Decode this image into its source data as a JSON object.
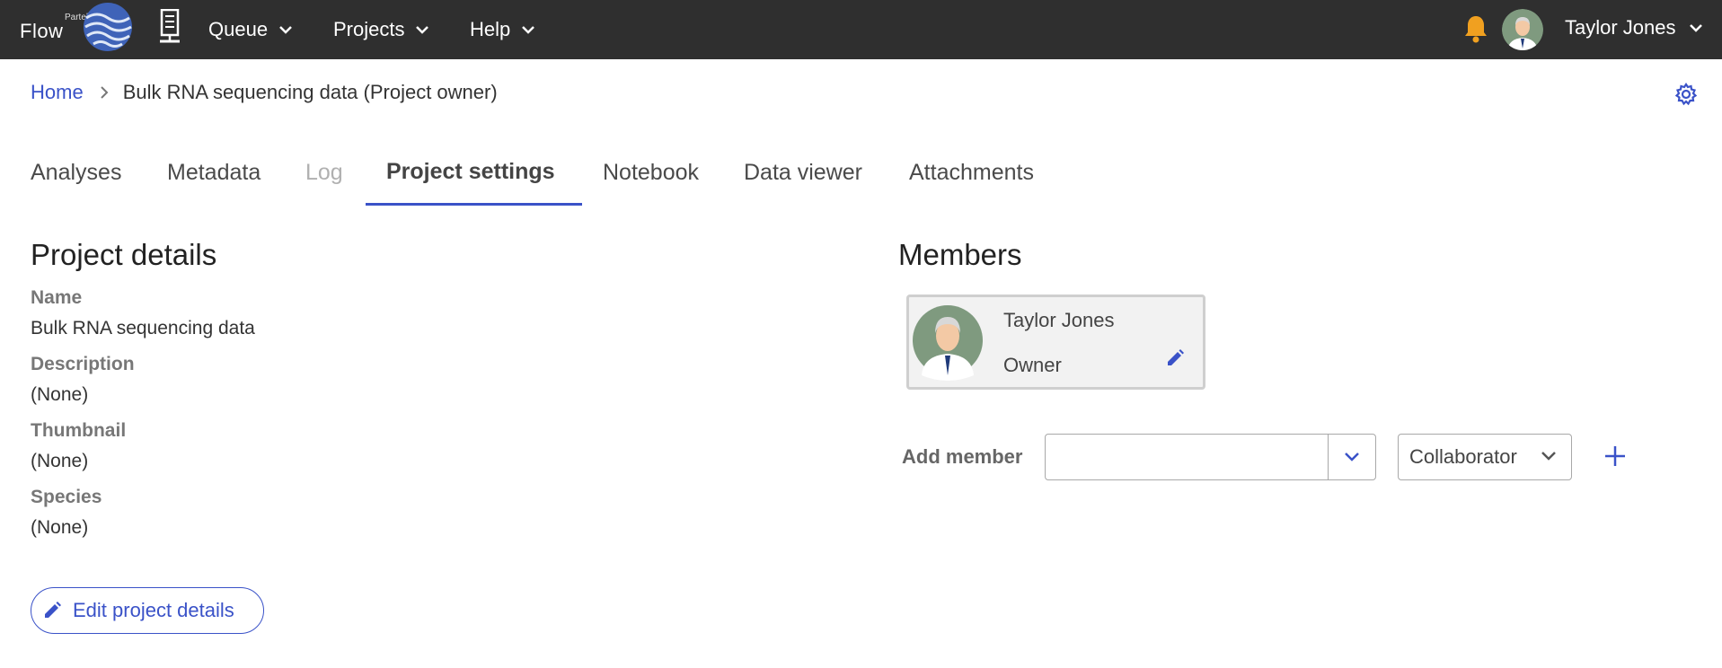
{
  "colors": {
    "accent": "#3a52c8",
    "topbar": "#2f2f2f",
    "bell": "#f0a020"
  },
  "topbar": {
    "brand_small": "Partek",
    "brand": "Flow",
    "nav": [
      {
        "label": "Queue"
      },
      {
        "label": "Projects"
      },
      {
        "label": "Help"
      }
    ],
    "user_name": "Taylor Jones"
  },
  "breadcrumb": {
    "home": "Home",
    "current": "Bulk RNA sequencing data (Project owner)"
  },
  "tabs": [
    {
      "label": "Analyses"
    },
    {
      "label": "Metadata"
    },
    {
      "label": "Log"
    },
    {
      "label": "Project settings"
    },
    {
      "label": "Notebook"
    },
    {
      "label": "Data viewer"
    },
    {
      "label": "Attachments"
    }
  ],
  "details": {
    "title": "Project details",
    "name_label": "Name",
    "name_value": "Bulk RNA sequencing data",
    "description_label": "Description",
    "description_value": "(None)",
    "thumbnail_label": "Thumbnail",
    "thumbnail_value": "(None)",
    "species_label": "Species",
    "species_value": "(None)",
    "edit_label": "Edit project details"
  },
  "members": {
    "title": "Members",
    "list": [
      {
        "name": "Taylor Jones",
        "role": "Owner"
      }
    ],
    "add_label": "Add member",
    "add_input_value": "",
    "role_selected": "Collaborator"
  }
}
